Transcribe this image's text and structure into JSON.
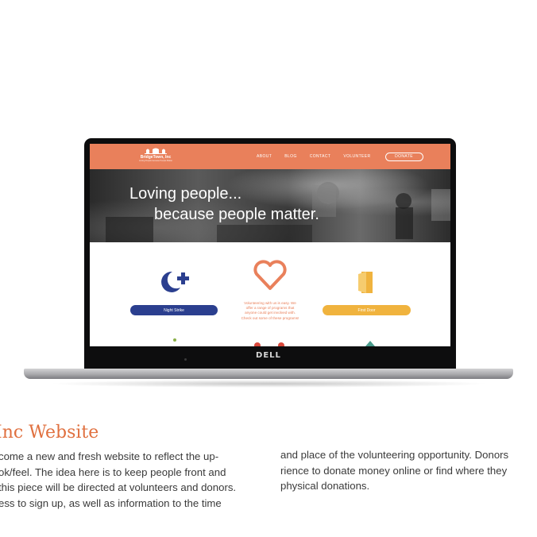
{
  "laptop": {
    "brand": "DELL"
  },
  "site": {
    "logo": {
      "name": "BridgeTown, Inc",
      "tagline": "Loving People because People Matter"
    },
    "nav": [
      "ABOUT",
      "BLOG",
      "CONTACT",
      "VOLUNTEER"
    ],
    "donate_label": "DONATE",
    "hero": {
      "line1": "Loving people...",
      "line2": "because people matter."
    },
    "programs": {
      "left_button": "Night Strike",
      "right_button": "First Door",
      "center_text": [
        "Volunteering with us is easy. We",
        "offer a range of programs that",
        "anyone could get involved with.",
        "Check out some of these programs!"
      ]
    },
    "colors": {
      "brand": "#e9805b",
      "navy": "#2b3f8f",
      "yellow": "#f0b33e"
    }
  },
  "page": {
    "title": "Inc Website",
    "left_column": [
      "come a new and fresh website to reflect the up-",
      "ok/feel. The idea here is to keep people front and",
      "this piece will be directed at volunteers and donors.",
      "ess to sign up, as well as information to the time"
    ],
    "right_column": [
      "and place of the volunteering opportunity. Donors",
      "rience to donate money online or find where they",
      "physical donations."
    ]
  }
}
